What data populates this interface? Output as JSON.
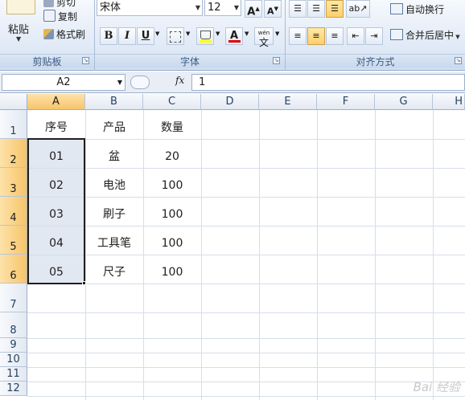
{
  "ribbon": {
    "clipboard": {
      "paste_label": "粘贴",
      "cut_label": "剪切",
      "copy_label": "复制",
      "format_painter_label": "格式刷",
      "group_label": "剪贴板"
    },
    "font": {
      "font_name": "宋体",
      "font_size": "12",
      "bold": "B",
      "italic": "I",
      "underline": "U",
      "grow": "A",
      "shrink": "A",
      "font_color_glyph": "A",
      "phonetic_glyph": "文",
      "group_label": "字体"
    },
    "alignment": {
      "wrap_text_label": "自动换行",
      "merge_center_label": "合并后居中",
      "group_label": "对齐方式"
    }
  },
  "formula_bar": {
    "name_box": "A2",
    "fx_label": "fx",
    "formula_value": "1"
  },
  "sheet": {
    "columns": [
      "A",
      "B",
      "C",
      "D",
      "E",
      "F",
      "G",
      "H"
    ],
    "rows": [
      "1",
      "2",
      "3",
      "4",
      "5",
      "6",
      "7",
      "8",
      "9",
      "10",
      "11",
      "12"
    ],
    "cells": {
      "A1": "序号",
      "B1": "产品",
      "C1": "数量",
      "A2": "01",
      "B2": "盆",
      "C2": "20",
      "A3": "02",
      "B3": "电池",
      "C3": "100",
      "A4": "03",
      "B4": "刷子",
      "C4": "100",
      "A5": "04",
      "B5": "工具笔",
      "C5": "100",
      "A6": "05",
      "B6": "尺子",
      "C6": "100"
    },
    "selection": "A2:A6"
  },
  "watermark": "Bai 经验",
  "colors": {
    "selected_header": "#f7c46a",
    "selected_range": "#e2e8f2",
    "ribbon_label": "#3b5a82"
  }
}
